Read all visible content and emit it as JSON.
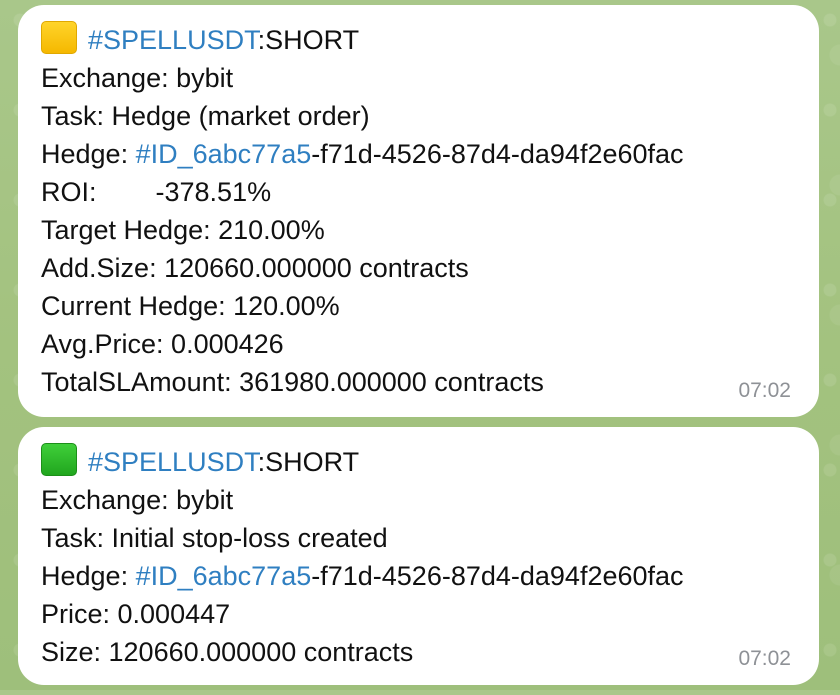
{
  "messages": [
    {
      "emoji": "yellow-square-emoji",
      "symbol_tag": "#SPELLUSDT",
      "direction": ":SHORT",
      "exchange": "Exchange: bybit",
      "task": "Task: Hedge (market order)",
      "hedge_label": "Hedge: ",
      "hedge_tag": "#ID_6abc77a5",
      "hedge_rest": "-f71d-4526-87d4-da94f2e60fac",
      "roi_label": "ROI:",
      "roi_value": "-378.51%",
      "target_hedge": "Target Hedge: 210.00%",
      "add_size": "Add.Size:  120660.000000 contracts",
      "current_hedge": "Current Hedge: 120.00%",
      "avg_price": "Avg.Price: 0.000426",
      "total_sl": "TotalSLAmount: 361980.000000 contracts",
      "time": "07:02"
    },
    {
      "emoji": "green-square-emoji",
      "symbol_tag": "#SPELLUSDT",
      "direction": ":SHORT",
      "exchange": "Exchange: bybit",
      "task": "Task: Initial stop-loss created",
      "hedge_label": "Hedge: ",
      "hedge_tag": "#ID_6abc77a5",
      "hedge_rest": "-f71d-4526-87d4-da94f2e60fac",
      "price": "Price: 0.000447",
      "size": "Size:  120660.000000 contracts",
      "time": "07:02"
    }
  ]
}
